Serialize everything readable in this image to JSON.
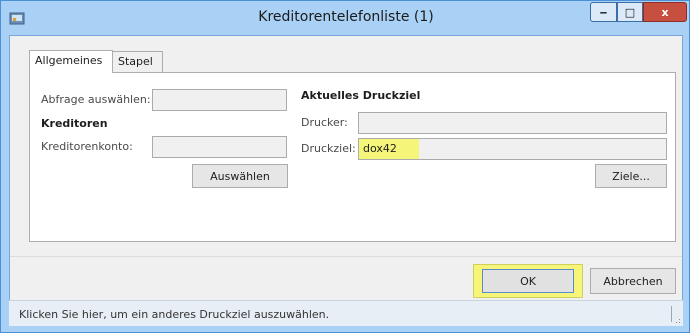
{
  "window": {
    "title": "Kreditorentelefonliste (1)",
    "icon": "app-icon",
    "controls": {
      "minimize": "‒",
      "maximize": "□",
      "close": "x"
    }
  },
  "tabs": [
    {
      "label": "Allgemeines",
      "active": true
    },
    {
      "label": "Stapel",
      "active": false
    }
  ],
  "general": {
    "query_label": "Abfrage auswählen:",
    "query_value": "",
    "vendors_heading": "Kreditoren",
    "vendor_account_label": "Kreditorenkonto:",
    "vendor_account_value": "",
    "select_button": "Auswählen"
  },
  "print_target": {
    "heading": "Aktuelles Druckziel",
    "printer_label": "Drucker:",
    "printer_value": "",
    "destination_label": "Druckziel:",
    "destination_value": "dox42",
    "targets_button": "Ziele..."
  },
  "footer": {
    "ok_button": "OK",
    "cancel_button": "Abbrechen"
  },
  "status": {
    "text": "Klicken Sie hier, um ein anderes Druckziel auszuwählen."
  },
  "colors": {
    "highlight": "#f5f57a",
    "titlebar": "#a9d0f5",
    "close_button": "#c74f3f"
  }
}
